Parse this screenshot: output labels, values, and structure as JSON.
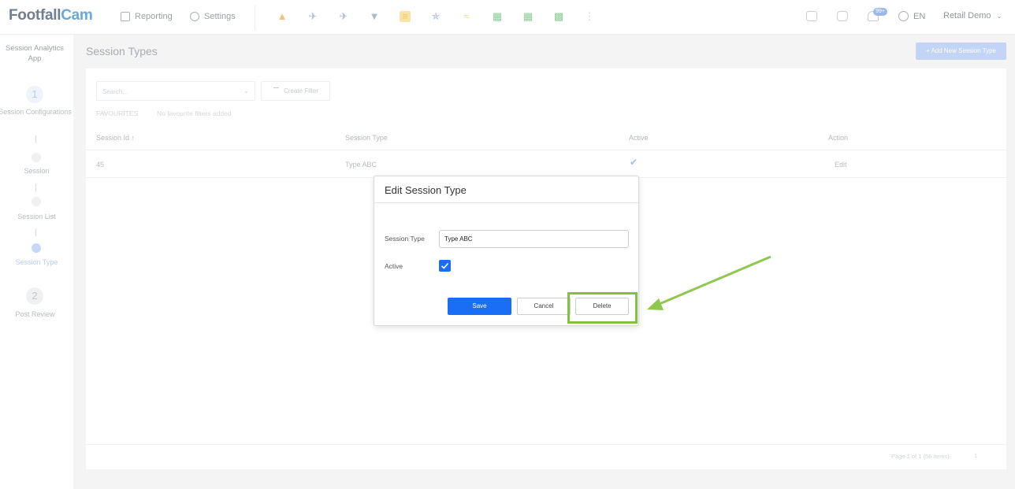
{
  "topbar": {
    "logo_part1": "Footfall",
    "logo_part2": "Cam",
    "nav_reporting": "Reporting",
    "nav_settings": "Settings",
    "notification_count": "99+",
    "language": "EN",
    "user": "Retail Demo"
  },
  "sidebar": {
    "app_title": "Session Analytics App",
    "steps": [
      {
        "number": "1",
        "label": "Session Configurations"
      },
      {
        "label": "Session"
      },
      {
        "label": "Session List"
      },
      {
        "label": "Session Type"
      },
      {
        "number": "2",
        "label": "Post Review"
      }
    ]
  },
  "page": {
    "title": "Session Types",
    "add_button": "+ Add New Session Type"
  },
  "filters": {
    "search_placeholder": "Search...",
    "create_filter": "Create Filter",
    "favourites_label": "FAVOURITES",
    "favourites_empty": "No favourite filters added"
  },
  "table": {
    "headers": [
      "Session Id ↑",
      "Session Type",
      "Active",
      "Action"
    ],
    "rows": [
      {
        "session_id": "45",
        "session_type": "Type ABC",
        "active": true,
        "action": "Edit"
      }
    ],
    "pager_text": "Page 1 of 1 (56 items)",
    "pager_page": "1"
  },
  "modal": {
    "title": "Edit Session Type",
    "session_type_label": "Session Type",
    "session_type_value": "Type ABC",
    "active_label": "Active",
    "active_checked": true,
    "save": "Save",
    "cancel": "Cancel",
    "delete": "Delete"
  },
  "annotation": {
    "highlight_color": "#82c141",
    "target": "Delete"
  }
}
